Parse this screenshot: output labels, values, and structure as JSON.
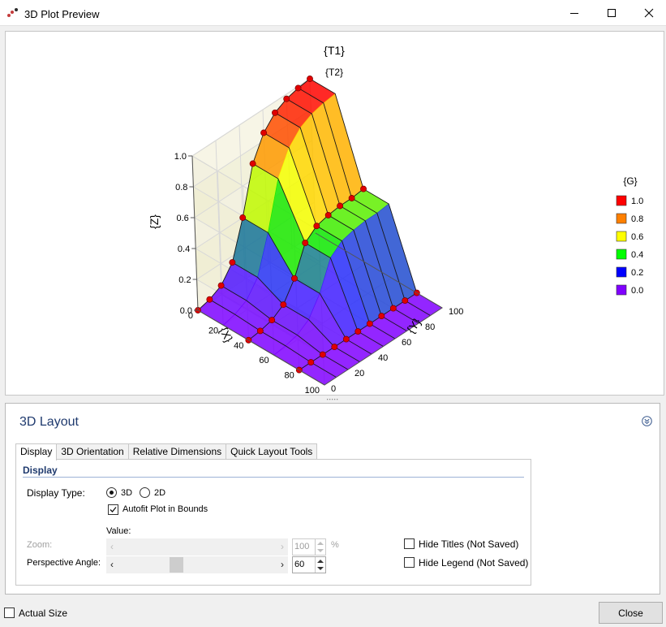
{
  "window": {
    "title": "3D Plot Preview",
    "min_glyph": "—",
    "max_glyph": "☐",
    "close_glyph": "✕"
  },
  "plot": {
    "title": "{T1}",
    "subtitle": "{T2}",
    "z_axis_label": "{Z}",
    "y_axis_label": "{X}",
    "x_axis_label": "{Y}",
    "legend_title": "{G}",
    "legend": [
      {
        "label": "1.0",
        "color": "#ff0000"
      },
      {
        "label": "0.8",
        "color": "#ff8000"
      },
      {
        "label": "0.6",
        "color": "#ffff00"
      },
      {
        "label": "0.4",
        "color": "#00ff00"
      },
      {
        "label": "0.2",
        "color": "#0000ff"
      },
      {
        "label": "0.0",
        "color": "#8000ff"
      }
    ],
    "chart_data": {
      "type": "surface",
      "title": "{T1}",
      "subtitle": "{T2}",
      "axis_labels": {
        "vertical": "{Z}",
        "front": "{X}",
        "right": "{Y}"
      },
      "vertical_ticks": [
        "0.0",
        "0.2",
        "0.4",
        "0.6",
        "0.8",
        "1.0"
      ],
      "front_ticks": [
        "0",
        "20",
        "40",
        "60",
        "80",
        "100"
      ],
      "right_ticks": [
        "0",
        "20",
        "40",
        "60",
        "80",
        "100"
      ],
      "ranges": {
        "vertical": [
          0,
          1
        ],
        "front": [
          0,
          100
        ],
        "right": [
          0,
          100
        ]
      },
      "grid": true,
      "legend_position": "right",
      "x": [
        0,
        10,
        20,
        30,
        40,
        50,
        60,
        70,
        80,
        90,
        100
      ],
      "y": [
        0,
        20,
        40,
        60,
        80,
        100
      ],
      "z": [
        [
          0.0,
          0.02,
          0.06,
          0.16,
          0.4,
          0.7,
          0.85,
          0.93,
          0.97,
          0.99,
          1.0
        ],
        [
          0.0,
          0.02,
          0.06,
          0.16,
          0.4,
          0.7,
          0.85,
          0.93,
          0.97,
          0.99,
          1.0
        ],
        [
          0.0,
          0.01,
          0.03,
          0.08,
          0.2,
          0.38,
          0.44,
          0.46,
          0.47,
          0.47,
          0.48
        ],
        [
          0.0,
          0.01,
          0.03,
          0.08,
          0.2,
          0.38,
          0.44,
          0.46,
          0.47,
          0.47,
          0.48
        ],
        [
          0.0,
          0.0,
          0.0,
          0.0,
          0.0,
          0.0,
          0.0,
          0.0,
          0.0,
          0.0,
          0.0
        ],
        [
          0.0,
          0.0,
          0.0,
          0.0,
          0.0,
          0.0,
          0.0,
          0.0,
          0.0,
          0.0,
          0.0
        ]
      ]
    }
  },
  "layout_panel": {
    "title": "3D Layout",
    "tabs": [
      "Display",
      "3D Orientation",
      "Relative Dimensions",
      "Quick Layout Tools"
    ],
    "section_title": "Display",
    "display_type_label": "Display Type:",
    "option_3d": "3D",
    "option_2d": "2D",
    "display_type_selected": "3D",
    "autofit_label": "Autofit Plot in Bounds",
    "autofit_checked": true,
    "value_header": "Value:",
    "zoom_label": "Zoom:",
    "zoom_value": "100",
    "zoom_unit": "%",
    "zoom_enabled": false,
    "perspective_label": "Perspective Angle:",
    "perspective_value": "60",
    "hide_titles_label": "Hide Titles (Not Saved)",
    "hide_titles_checked": false,
    "hide_legend_label": "Hide Legend (Not Saved)",
    "hide_legend_checked": false
  },
  "footer": {
    "actual_size_label": "Actual Size",
    "actual_size_checked": false,
    "close_label": "Close"
  }
}
